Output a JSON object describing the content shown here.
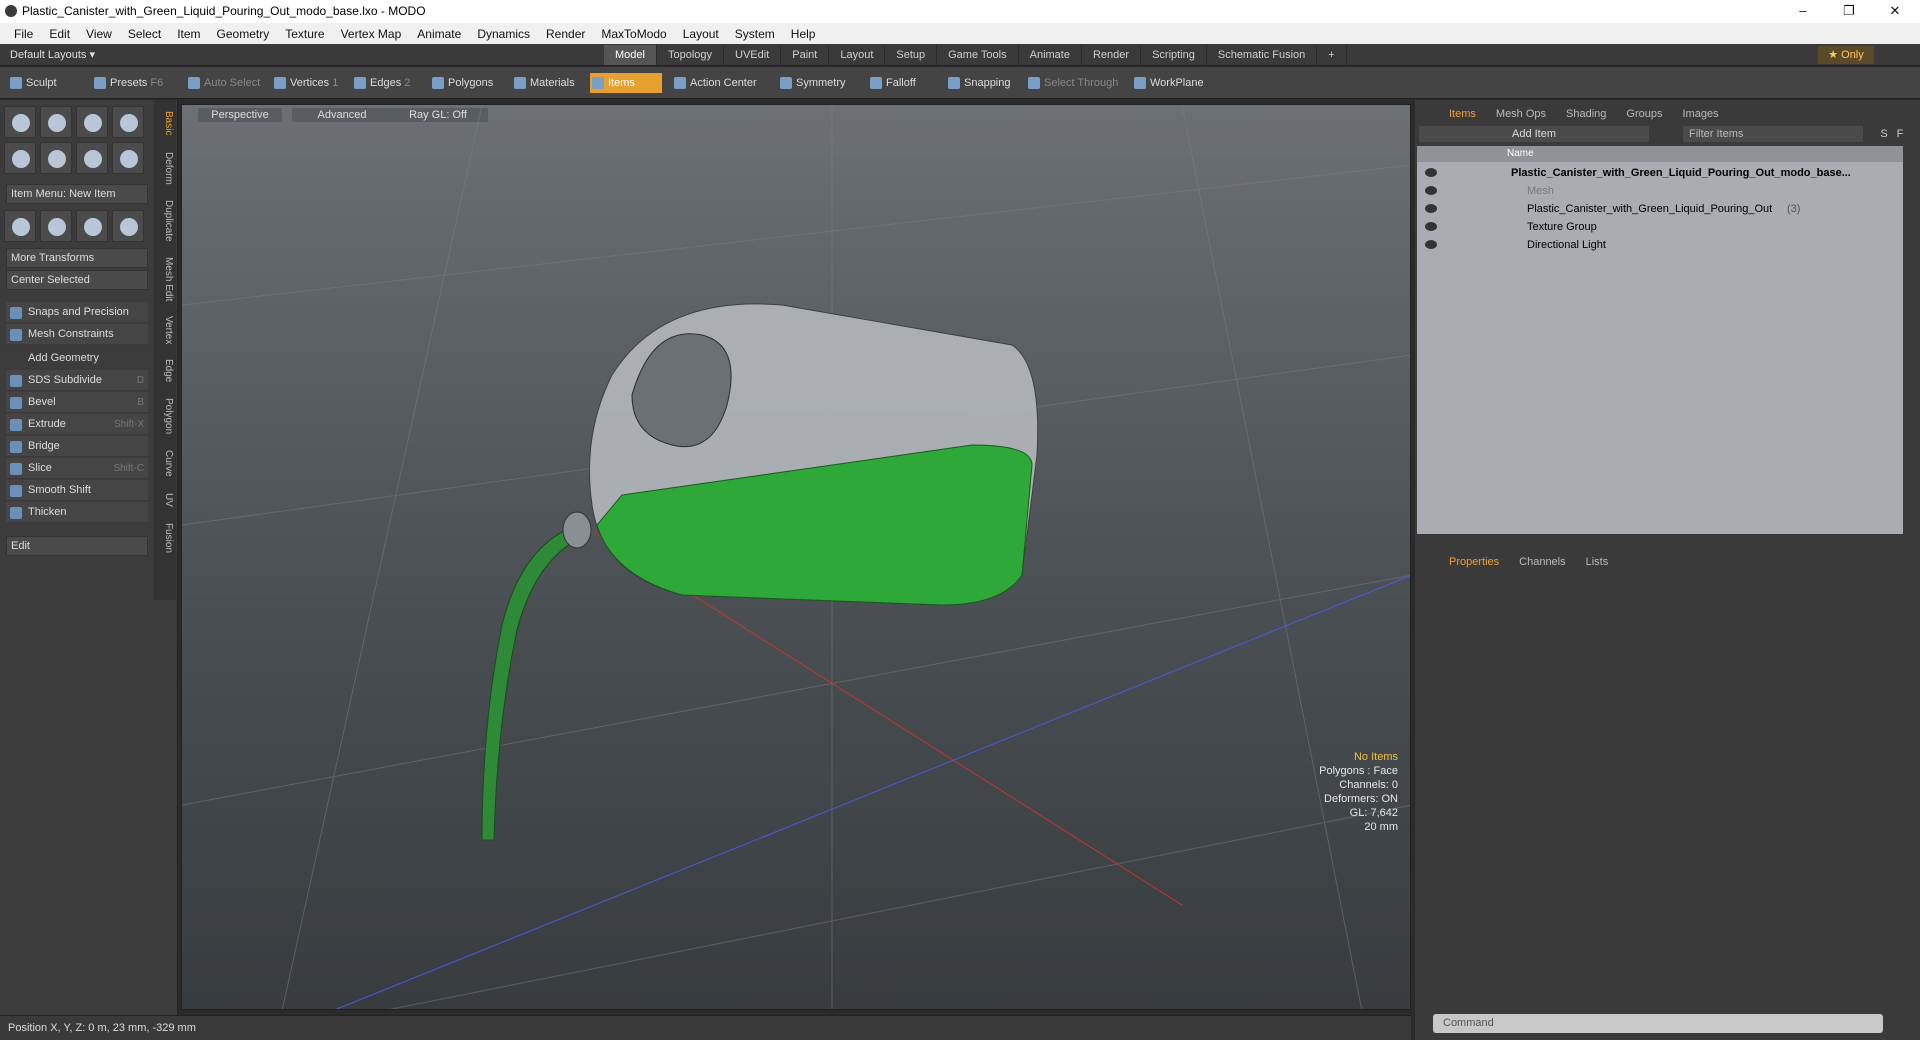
{
  "window": {
    "title": "Plastic_Canister_with_Green_Liquid_Pouring_Out_modo_base.lxo - MODO",
    "minimize": "–",
    "maximize": "❐",
    "close": "✕"
  },
  "menu": [
    "File",
    "Edit",
    "View",
    "Select",
    "Item",
    "Geometry",
    "Texture",
    "Vertex Map",
    "Animate",
    "Dynamics",
    "Render",
    "MaxToModo",
    "Layout",
    "System",
    "Help"
  ],
  "layoutbar": {
    "layout": "Default Layouts ▾",
    "tabs": [
      "Model",
      "Topology",
      "UVEdit",
      "Paint",
      "Layout",
      "Setup",
      "Game Tools",
      "Animate",
      "Render",
      "Scripting",
      "Schematic Fusion"
    ],
    "active": "Model",
    "plus": "+",
    "only": "★ Only"
  },
  "toolbar": {
    "sculpt": "Sculpt",
    "presets": "Presets",
    "presets_key": "F6",
    "auto_select": "Auto Select",
    "vertices": "Vertices",
    "vertices_n": "1",
    "edges": "Edges",
    "edges_n": "2",
    "polygons": "Polygons",
    "materials": "Materials",
    "items": "Items",
    "action_center": "Action Center",
    "symmetry": "Symmetry",
    "falloff": "Falloff",
    "snapping": "Snapping",
    "select_through": "Select Through",
    "workplane": "WorkPlane"
  },
  "left": {
    "item_menu": "Item Menu: New Item",
    "more_transforms": "More Transforms",
    "center_selected": "Center Selected",
    "snaps": "Snaps and Precision",
    "mesh_constraints": "Mesh Constraints",
    "add_geometry": "Add Geometry",
    "tools": [
      {
        "label": "SDS Subdivide",
        "key": "D"
      },
      {
        "label": "Bevel",
        "key": "B"
      },
      {
        "label": "Extrude",
        "key": "Shift-X"
      },
      {
        "label": "Bridge",
        "key": ""
      },
      {
        "label": "Slice",
        "key": "Shift-C"
      },
      {
        "label": "Smooth Shift",
        "key": ""
      },
      {
        "label": "Thicken",
        "key": ""
      }
    ],
    "edit": "Edit",
    "vtabs": [
      "Basic",
      "Deform",
      "Duplicate",
      "Mesh Edit",
      "Vertex",
      "Edge",
      "Polygon",
      "Curve",
      "UV",
      "Fusion"
    ]
  },
  "viewport": {
    "view": "Perspective",
    "shading": "Advanced",
    "raygl": "Ray GL: Off",
    "info": [
      "No Items",
      "Polygons : Face",
      "Channels: 0",
      "Deformers: ON",
      "GL: 7,642",
      "20 mm"
    ]
  },
  "status": {
    "position": "Position X, Y, Z:   0 m, 23 mm, -329 mm"
  },
  "right": {
    "tabs": [
      "Items",
      "Mesh Ops",
      "Shading",
      "Groups",
      "Images"
    ],
    "add_item": "Add Item",
    "filter": "Filter Items",
    "s": "S",
    "f": "F",
    "name_col": "Name",
    "tree": [
      "Plastic_Canister_with_Green_Liquid_Pouring_Out_modo_base...",
      "Mesh",
      "Plastic_Canister_with_Green_Liquid_Pouring_Out",
      "Texture Group",
      "Directional Light"
    ],
    "tree_count": "(3)",
    "ptabs": [
      "Properties",
      "Channels",
      "Lists"
    ],
    "command": "Command"
  }
}
